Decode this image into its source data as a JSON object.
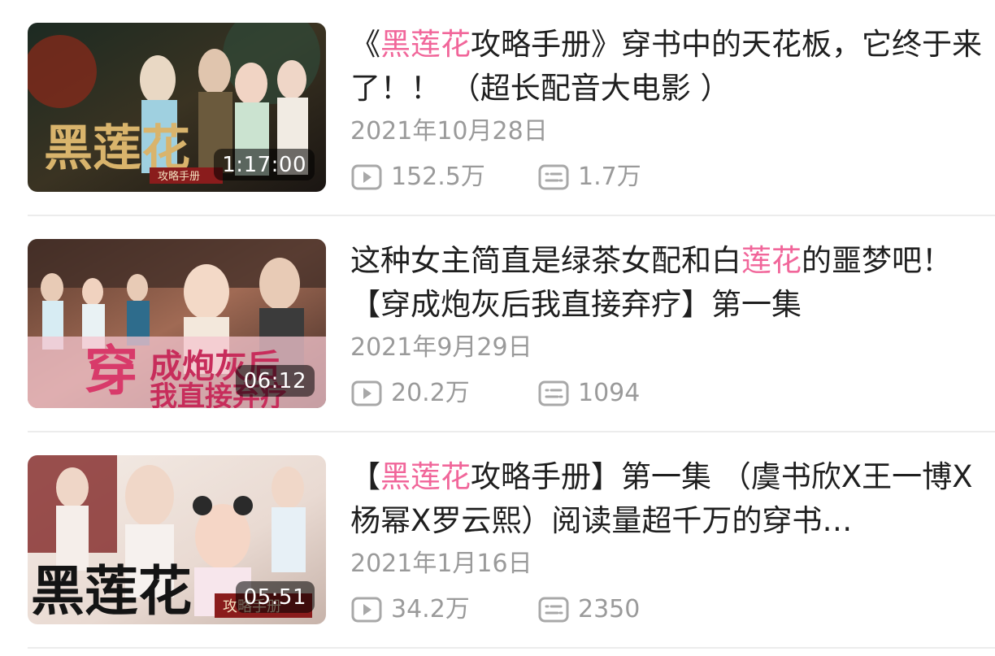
{
  "videos": [
    {
      "title_parts": [
        {
          "text": "《",
          "hl": false
        },
        {
          "text": "黑莲花",
          "hl": true
        },
        {
          "text": "攻略手册》穿书中的天花板，它终于来了！！ （超长配音大电影 ）",
          "hl": false
        }
      ],
      "duration": "1:17:00",
      "date": "2021年10月28日",
      "plays": "152.5万",
      "comments": "1.7万",
      "thumb_icon": "drama-poster-thumbnail"
    },
    {
      "title_parts": [
        {
          "text": "这种女主简直是绿茶女配和白",
          "hl": false
        },
        {
          "text": "莲花",
          "hl": true
        },
        {
          "text": "的噩梦吧！【穿成炮灰后我直接弃疗】第一集",
          "hl": false
        }
      ],
      "duration": "06:12",
      "date": "2021年9月29日",
      "plays": "20.2万",
      "comments": "1094",
      "thumb_icon": "drama-poster-thumbnail"
    },
    {
      "title_parts": [
        {
          "text": "【",
          "hl": false
        },
        {
          "text": "黑莲花",
          "hl": true
        },
        {
          "text": "攻略手册】第一集 （虞书欣X王一博X杨幂X罗云熙）阅读量超千万的穿书…",
          "hl": false
        }
      ],
      "duration": "05:51",
      "date": "2021年1月16日",
      "plays": "34.2万",
      "comments": "2350",
      "thumb_icon": "drama-poster-thumbnail"
    }
  ],
  "colors": {
    "highlight": "#f1669a",
    "meta": "#9a9a9a",
    "title": "#1f1f1f"
  },
  "icons": {
    "plays": "play-count-icon",
    "comments": "danmaku-comment-icon"
  }
}
